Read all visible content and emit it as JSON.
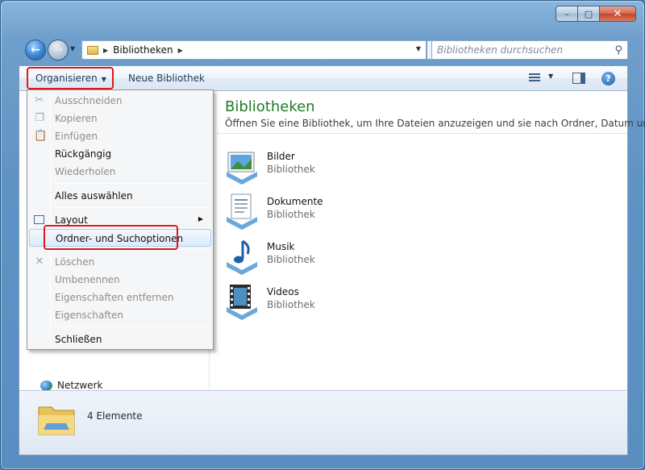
{
  "window": {
    "caption_buttons": {
      "minimize": "–",
      "maximize": "□",
      "close": "✕"
    }
  },
  "navigation": {
    "back_icon": "arrow-left-icon",
    "forward_icon": "arrow-right-icon",
    "address": {
      "segment": "Bibliotheken"
    },
    "search": {
      "placeholder": "Bibliotheken durchsuchen"
    }
  },
  "toolbar": {
    "organize_label": "Organisieren",
    "new_library_label": "Neue Bibliothek"
  },
  "menu": {
    "items": [
      {
        "label": "Ausschneiden",
        "enabled": false,
        "icon": "scissors-icon"
      },
      {
        "label": "Kopieren",
        "enabled": false,
        "icon": "copy-icon"
      },
      {
        "label": "Einfügen",
        "enabled": false,
        "icon": "paste-icon"
      },
      {
        "label": "Rückgängig",
        "enabled": true
      },
      {
        "label": "Wiederholen",
        "enabled": false
      },
      {
        "label": "Alles auswählen",
        "enabled": true
      },
      {
        "label": "Layout",
        "enabled": true,
        "submenu": true,
        "icon": "layout-icon"
      },
      {
        "label": "Ordner- und Suchoptionen",
        "enabled": true,
        "highlighted": true
      },
      {
        "label": "Löschen",
        "enabled": false,
        "icon": "delete-icon"
      },
      {
        "label": "Umbenennen",
        "enabled": false
      },
      {
        "label": "Eigenschaften entfernen",
        "enabled": false
      },
      {
        "label": "Eigenschaften",
        "enabled": false
      },
      {
        "label": "Schließen",
        "enabled": true
      }
    ]
  },
  "nav_pane": {
    "network_label": "Netzwerk"
  },
  "content": {
    "title": "Bibliotheken",
    "subtitle": "Öffnen Sie eine Bibliothek, um Ihre Dateien anzuzeigen und sie nach Ordner, Datum un...",
    "libraries": [
      {
        "name": "Bilder",
        "kind": "Bibliothek",
        "icon": "pictures-library-icon"
      },
      {
        "name": "Dokumente",
        "kind": "Bibliothek",
        "icon": "documents-library-icon"
      },
      {
        "name": "Musik",
        "kind": "Bibliothek",
        "icon": "music-library-icon"
      },
      {
        "name": "Videos",
        "kind": "Bibliothek",
        "icon": "videos-library-icon"
      }
    ]
  },
  "status": {
    "item_count": "4 Elemente"
  },
  "colors": {
    "title_green": "#1e7b25",
    "highlight_red": "#e0171e",
    "frame_blue": "#5a8ec1"
  }
}
